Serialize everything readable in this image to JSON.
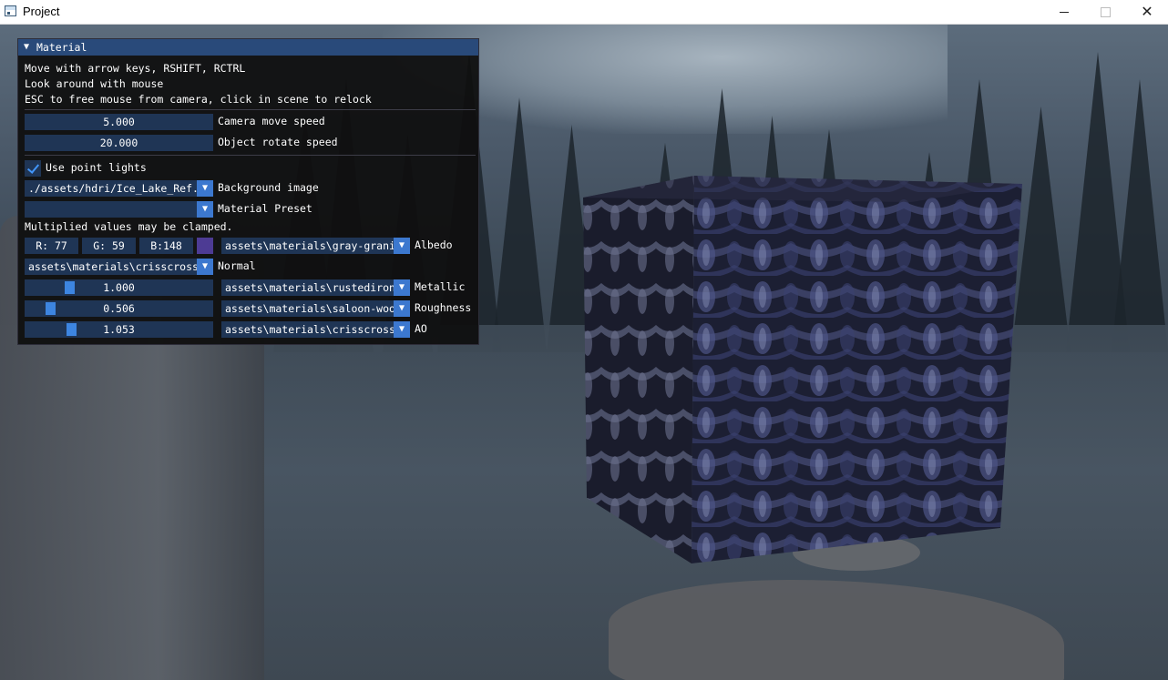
{
  "window": {
    "title": "Project"
  },
  "panel": {
    "title": "Material",
    "help_lines": [
      "Move with arrow keys, RSHIFT, RCTRL",
      "Look around with mouse",
      "ESC to free mouse from camera, click in scene to relock"
    ],
    "camera_speed": {
      "value": "5.000",
      "label": "Camera move speed"
    },
    "rotate_speed": {
      "value": "20.000",
      "label": "Object rotate speed"
    },
    "point_lights": {
      "label": "Use point lights",
      "checked": true
    },
    "background": {
      "value": "./assets/hdri/Ice_Lake_Ref.hdr",
      "label": "Background image"
    },
    "preset": {
      "value": "",
      "label": "Material Preset"
    },
    "clamp_note": "Multiplied values may be clamped.",
    "albedo": {
      "r": "R: 77",
      "g": "G: 59",
      "b": "B:148",
      "swatch_color": "#4d3b94",
      "texture": "assets\\materials\\gray-granite",
      "label": "Albedo"
    },
    "normal": {
      "texture": "assets\\materials\\crisscross",
      "label": "Normal"
    },
    "metallic": {
      "value": "1.000",
      "level": 0.22,
      "texture": "assets\\materials\\rustediron",
      "label": "Metallic"
    },
    "roughness": {
      "value": "0.506",
      "level": 0.11,
      "texture": "assets\\materials\\saloon-wood",
      "label": "Roughness"
    },
    "ao": {
      "value": "1.053",
      "level": 0.23,
      "texture": "assets\\materials\\crisscross",
      "label": "AO"
    }
  },
  "colors": {
    "title_active": "#294a7a",
    "frame_bg": "#1f3555",
    "button": "#3c78cf",
    "slider_grab": "#3d85e0",
    "check": "#4296fa"
  }
}
